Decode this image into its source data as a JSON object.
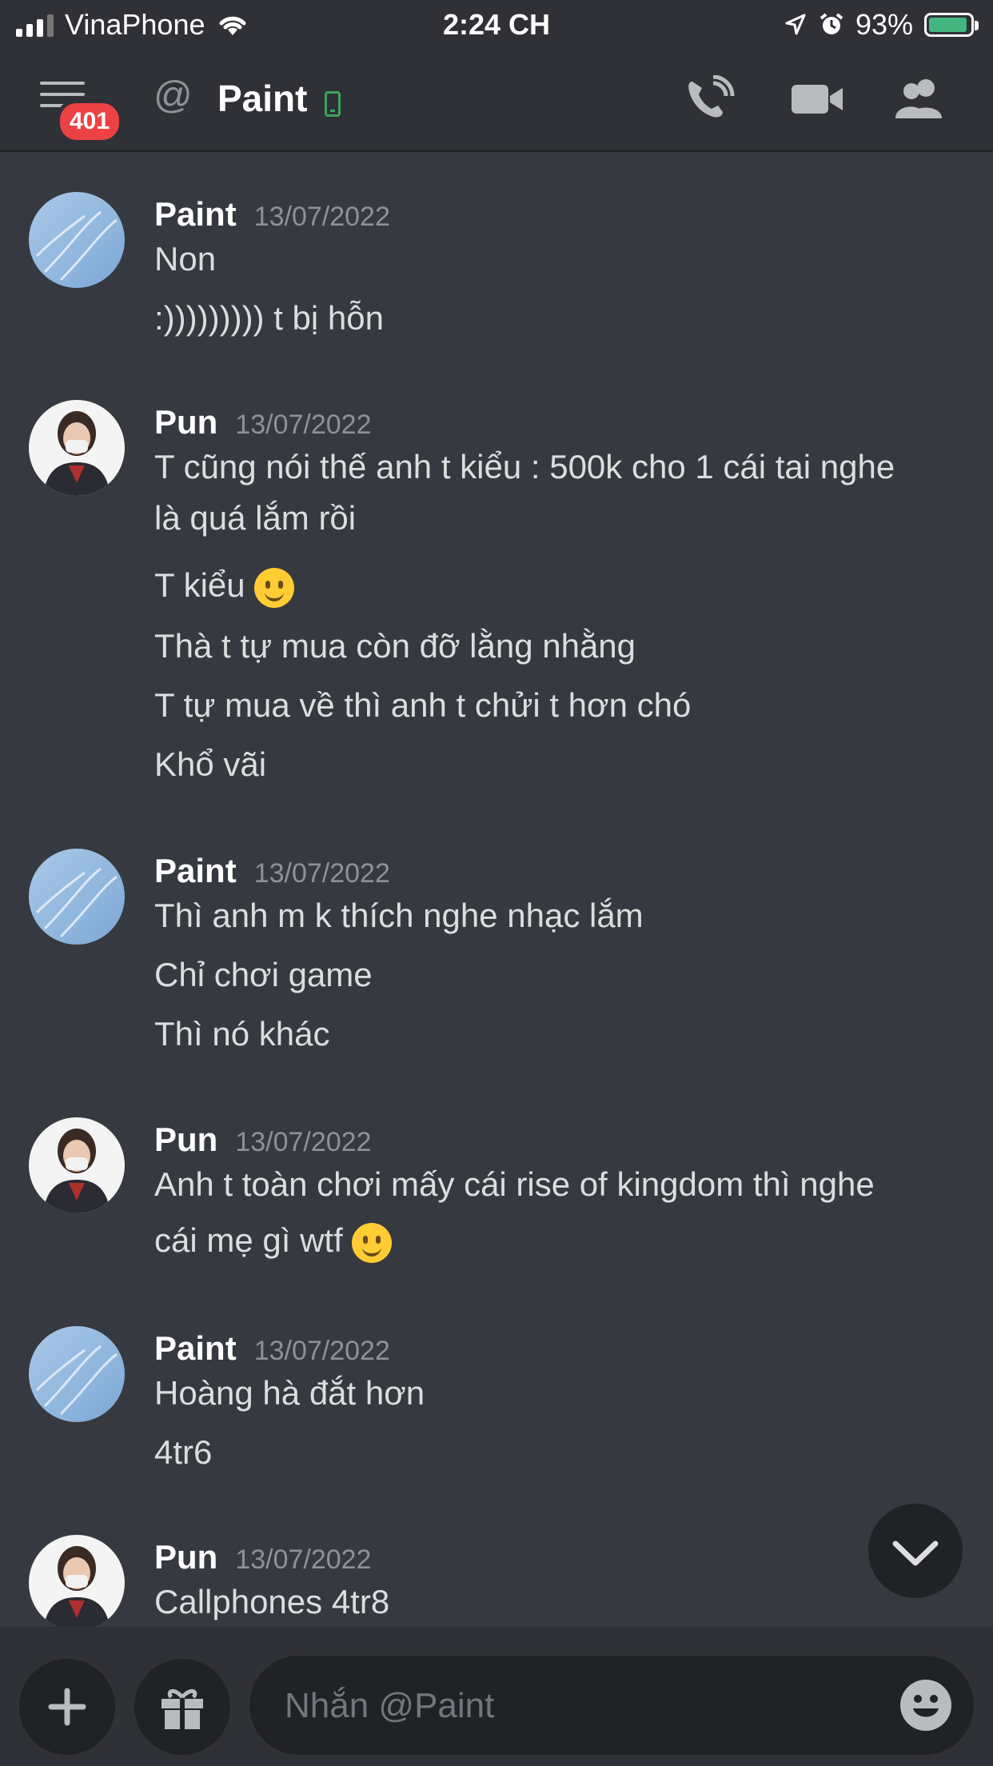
{
  "status_bar": {
    "carrier": "VinaPhone",
    "time": "2:24 CH",
    "battery": "93%"
  },
  "header": {
    "unread_count": "401",
    "channel_name": "Paint"
  },
  "messages": [
    {
      "author": "Paint",
      "timestamp": "13/07/2022",
      "avatar": "sky",
      "lines": [
        "Non",
        ":))))))))) t bị hỗn"
      ]
    },
    {
      "author": "Pun",
      "timestamp": "13/07/2022",
      "avatar": "person",
      "lines": [
        "T cũng nói thế anh t kiểu : 500k cho 1 cái tai nghe",
        "là quá lắm rồi",
        "T kiểu",
        "Thà t tự mua còn đỡ lằng nhằng",
        "T tự mua về thì anh t chửi t hơn chó",
        "Khổ vãi"
      ]
    },
    {
      "author": "Paint",
      "timestamp": "13/07/2022",
      "avatar": "sky",
      "lines": [
        "Thì anh m k thích nghe nhạc lắm",
        "Chỉ chơi game",
        "Thì nó khác"
      ]
    },
    {
      "author": "Pun",
      "timestamp": "13/07/2022",
      "avatar": "person",
      "lines": [
        "Anh t toàn chơi mấy cái rise of kingdom thì nghe",
        "cái mẹ gì wtf"
      ]
    },
    {
      "author": "Paint",
      "timestamp": "13/07/2022",
      "avatar": "sky",
      "lines": [
        "Hoàng hà đắt hơn",
        "4tr6"
      ]
    },
    {
      "author": "Pun",
      "timestamp": "13/07/2022",
      "avatar": "person",
      "lines": [
        "Callphones 4tr8"
      ]
    }
  ],
  "composer": {
    "placeholder": "Nhắn @Paint"
  },
  "colors": {
    "background": "#36393f",
    "badge": "#ed4245",
    "online_mobile": "#3ba55d",
    "battery_fill": "#43b581"
  }
}
